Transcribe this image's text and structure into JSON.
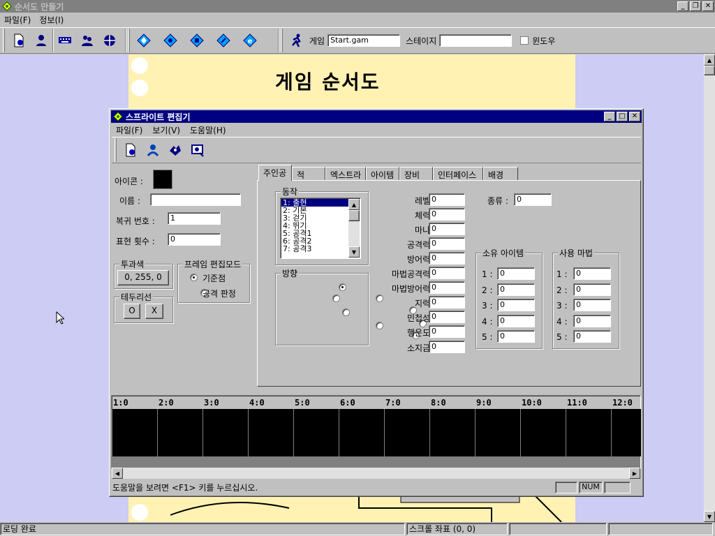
{
  "app": {
    "title": "순서도 만들기",
    "menu": [
      "파일(F)",
      "정보(I)"
    ],
    "toolbar": {
      "game_label": "게임",
      "game_value": "Start.gam",
      "stage_label": "스테이지",
      "stage_value": "",
      "window_label": "윈도우"
    },
    "canvas_title": "게임 순서도",
    "status": {
      "left": "로딩 완료",
      "right": "스크롤 좌표 (0, 0)"
    }
  },
  "dialog": {
    "title": "스프라이트 편집기",
    "menu": [
      "파일(F)",
      "보기(V)",
      "도움말(H)"
    ],
    "left": {
      "icon_label": "아이콘 :",
      "name_label": "이름 :",
      "name_value": "",
      "return_label": "복귀 번호 :",
      "return_value": "1",
      "count_label": "표현 횟수 :",
      "count_value": "0",
      "transparent_title": "투과색",
      "transparent_value": "0, 255, 0",
      "frame_title": "프레임 편집모드",
      "radio_base": "기준점",
      "radio_attack": "공격 판정",
      "border_title": "테두리선",
      "border_o": "O",
      "border_x": "X"
    },
    "tabs": [
      "주인공",
      "적",
      "엑스트라",
      "아이템",
      "장비",
      "인터페이스",
      "배경"
    ],
    "action_title": "동작",
    "actions": [
      "1: 출현",
      "2: 기본",
      "3: 걷기",
      "4: 뛰기",
      "5: 공격1",
      "6: 공격2",
      "7: 공격3"
    ],
    "direction_title": "방향",
    "stats": [
      {
        "label": "레벨 :",
        "value": "0"
      },
      {
        "label": "체력 :",
        "value": "0"
      },
      {
        "label": "마나 :",
        "value": "0"
      },
      {
        "label": "공격력 :",
        "value": "0"
      },
      {
        "label": "방어력 :",
        "value": "0"
      },
      {
        "label": "마법공격력 :",
        "value": "0"
      },
      {
        "label": "마법방어력 :",
        "value": "0"
      },
      {
        "label": "지력 :",
        "value": "0"
      },
      {
        "label": "민첩성 :",
        "value": "0"
      },
      {
        "label": "행운도 :",
        "value": "0"
      },
      {
        "label": "소지금 :",
        "value": "0"
      }
    ],
    "kind_label": "종류 :",
    "kind_value": "0",
    "items_title": "소유 아이템",
    "magic_title": "사용 마법",
    "slots": [
      "1 :",
      "2 :",
      "3 :",
      "4 :",
      "5 :"
    ],
    "slot_value": "0",
    "timeline": [
      "1:0",
      "2:0",
      "3:0",
      "4:0",
      "5:0",
      "6:0",
      "7:0",
      "8:0",
      "9:0",
      "10:0",
      "11:0",
      "12:0"
    ],
    "status": {
      "help": "도움말을 보려면 <F1> 키를 누르십시오.",
      "num": "NUM"
    }
  },
  "colors": {
    "face": "#c0c0c0",
    "titlebar_inactive": "#808080",
    "titlebar_active": "#000080",
    "workspace": "#ccccf4",
    "paper": "#fff2b3"
  }
}
